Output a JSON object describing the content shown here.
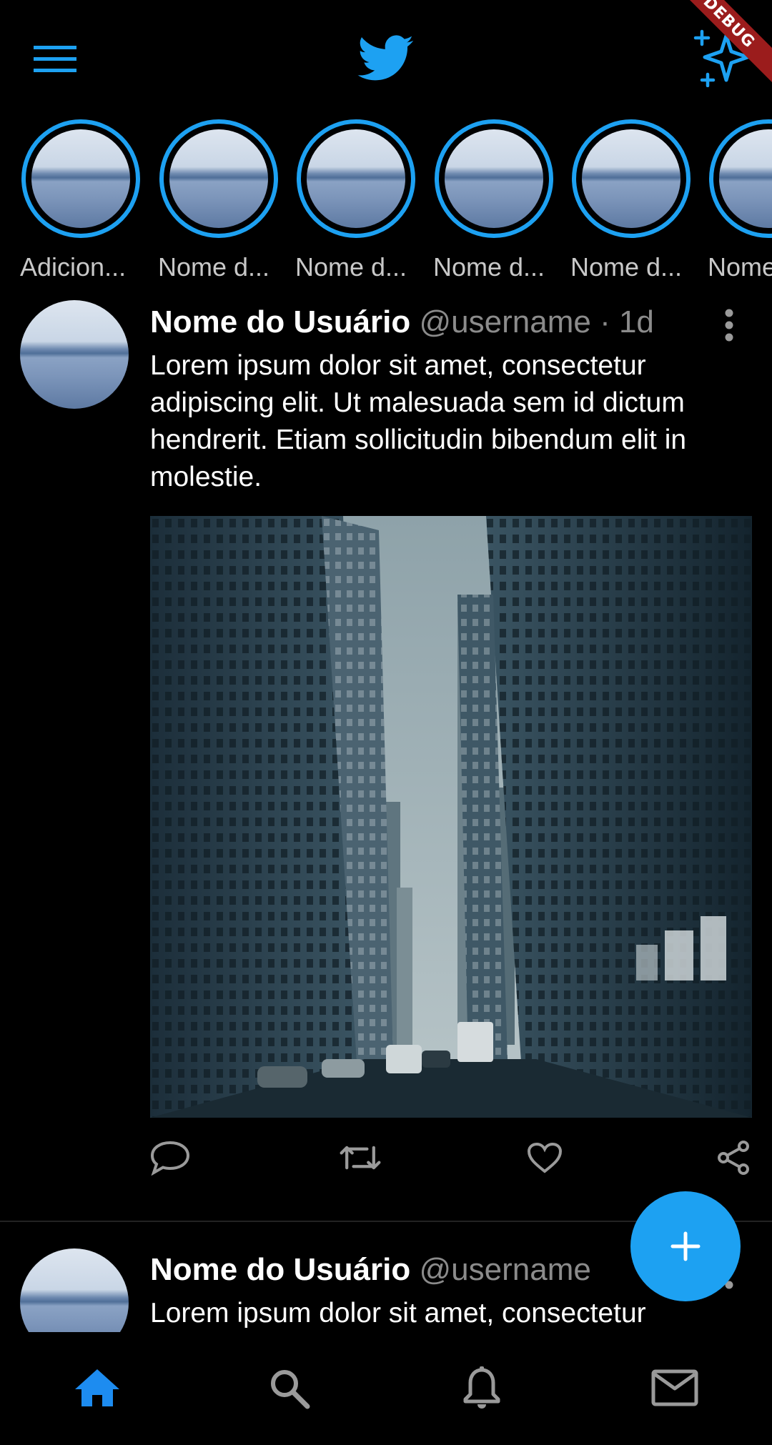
{
  "app_bar": {
    "menu_icon": "hamburger-menu-icon",
    "logo_icon": "twitter-bird-icon",
    "sparkle_icon": "sparkle-icon",
    "debug_banner": "DEBUG",
    "accent_color": "#1da1f2"
  },
  "stories": [
    {
      "label": "Adicion..."
    },
    {
      "label": "Nome d..."
    },
    {
      "label": "Nome d..."
    },
    {
      "label": "Nome d..."
    },
    {
      "label": "Nome d..."
    },
    {
      "label": "Nome"
    }
  ],
  "tweets": [
    {
      "name": "Nome do Usuário",
      "handle": "@username",
      "time": "· 1d",
      "text": "Lorem ipsum dolor sit amet, consectetur adipiscing elit. Ut malesuada sem id dictum hendrerit. Etiam sollicitudin bibendum elit in molestie.",
      "actions": [
        "reply-icon",
        "retweet-icon",
        "like-icon",
        "share-icon"
      ]
    },
    {
      "name": "Nome do Usuário",
      "handle": "@username",
      "text": "Lorem ipsum dolor sit amet, consectetur"
    }
  ],
  "fab": {
    "icon": "plus-icon"
  },
  "bottom_nav": [
    {
      "icon": "home-icon",
      "active": true
    },
    {
      "icon": "search-icon",
      "active": false
    },
    {
      "icon": "bell-icon",
      "active": false
    },
    {
      "icon": "mail-icon",
      "active": false
    }
  ]
}
